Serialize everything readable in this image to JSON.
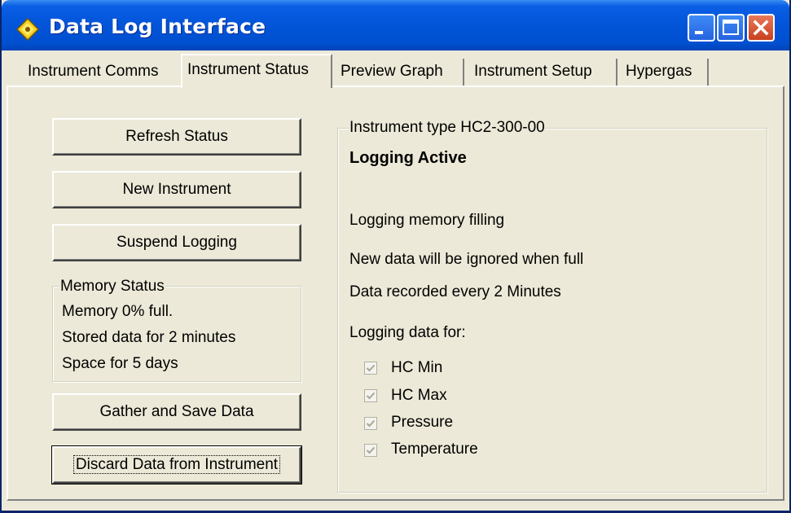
{
  "window": {
    "title": "Data Log Interface",
    "app_icon": "diamond-app-icon",
    "controls": [
      "minimize-icon",
      "maximize-icon",
      "close-icon"
    ]
  },
  "tabs": [
    {
      "label": "Instrument Comms",
      "active": false
    },
    {
      "label": "Instrument Status",
      "active": true
    },
    {
      "label": "Preview Graph",
      "active": false
    },
    {
      "label": "Instrument Setup",
      "active": false
    },
    {
      "label": "Hypergas",
      "active": false
    }
  ],
  "buttons": {
    "refresh": "Refresh Status",
    "new_instrument": "New Instrument",
    "suspend": "Suspend Logging",
    "gather": "Gather and Save Data",
    "discard": "Discard Data from Instrument"
  },
  "memory_status": {
    "title": "Memory Status",
    "lines": [
      "Memory 0% full.",
      "Stored data for 2 minutes",
      "Space for 5 days"
    ]
  },
  "instrument": {
    "group_title": "Instrument type HC2-300-00",
    "state": "Logging Active",
    "lines": [
      "Logging memory filling",
      "New data will be ignored when full",
      "Data recorded every 2 Minutes",
      "Logging data for:"
    ],
    "checkboxes": [
      {
        "label": "HC Min",
        "checked": true
      },
      {
        "label": "HC Max",
        "checked": true
      },
      {
        "label": "Pressure",
        "checked": true
      },
      {
        "label": "Temperature",
        "checked": true
      }
    ]
  },
  "colors": {
    "titlebar": "#0254d8",
    "face": "#ece9d8",
    "close_button": "#c8401f"
  }
}
